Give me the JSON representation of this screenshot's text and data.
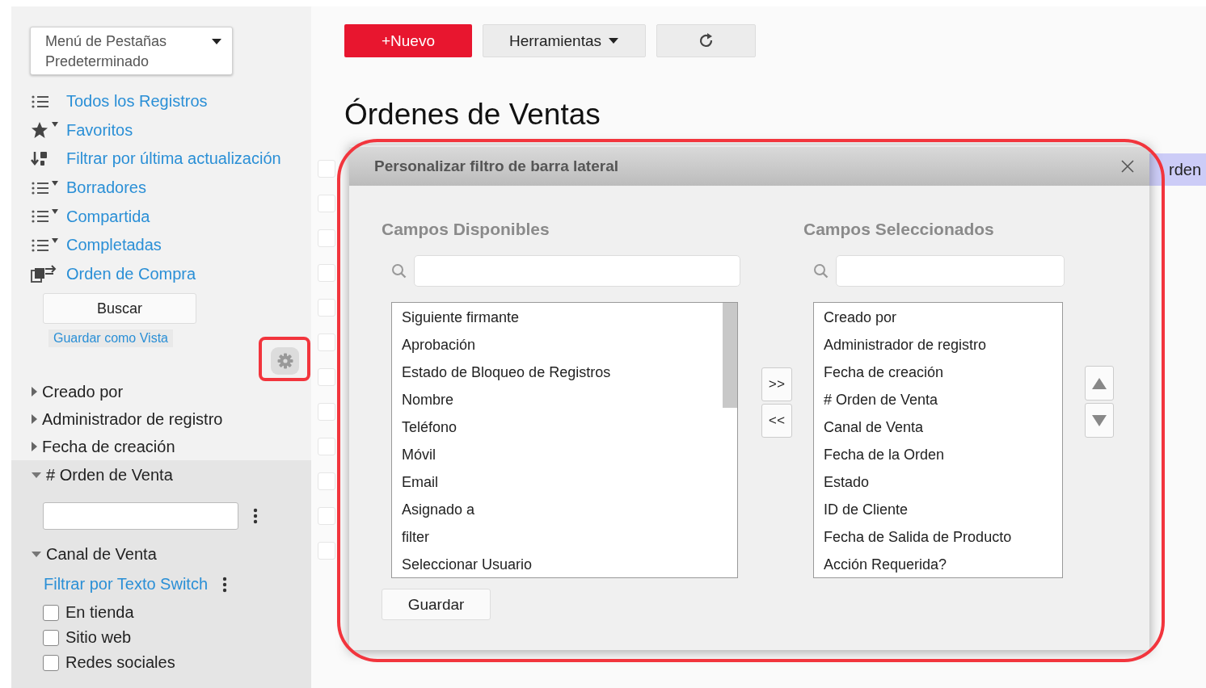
{
  "sidebar": {
    "tab_menu": {
      "label": "Menú de Pestañas Predeterminado"
    },
    "views": [
      {
        "label": "Todos los Registros",
        "kind": "list"
      },
      {
        "label": "Favoritos",
        "kind": "star"
      },
      {
        "label": "Filtrar por última actualización",
        "kind": "sort"
      },
      {
        "label": "Borradores",
        "kind": "filter"
      },
      {
        "label": "Compartida",
        "kind": "filter"
      },
      {
        "label": "Completadas",
        "kind": "filter"
      },
      {
        "label": "Orden de Compra",
        "kind": "transfer"
      }
    ],
    "search_button": "Buscar",
    "save_view_link": "Guardar como Vista",
    "filters": [
      {
        "label": "Creado por",
        "expanded": false
      },
      {
        "label": "Administrador de registro",
        "expanded": false
      },
      {
        "label": "Fecha de creación",
        "expanded": false
      },
      {
        "label": "# Orden de Venta",
        "expanded": true,
        "kind": "text"
      },
      {
        "label": "Canal de Venta",
        "expanded": true,
        "kind": "options",
        "link": "Filtrar por Texto Switch",
        "options": [
          {
            "label": "En tienda",
            "checked": false
          },
          {
            "label": "Sitio web",
            "checked": false
          },
          {
            "label": "Redes sociales",
            "checked": false
          }
        ]
      }
    ]
  },
  "toolbar": {
    "new_button": "+Nuevo",
    "tools_button": "Herramientas"
  },
  "page_title": "Órdenes de Ventas",
  "column_header": "rden",
  "rows": [
    {
      "checked": false
    },
    {
      "checked": false
    },
    {
      "checked": false
    },
    {
      "checked": false
    },
    {
      "checked": false
    },
    {
      "checked": false
    },
    {
      "checked": false
    },
    {
      "checked": false
    },
    {
      "checked": false
    },
    {
      "checked": false
    },
    {
      "checked": false
    },
    {
      "checked": false
    }
  ],
  "dialog": {
    "title": "Personalizar filtro de barra lateral",
    "available": {
      "heading": "Campos Disponibles",
      "items": [
        "Siguiente firmante",
        "Aprobación",
        "Estado de Bloqueo de Registros",
        "Nombre",
        "Teléfono",
        "Móvil",
        "Email",
        "Asignado a",
        "filter",
        "Seleccionar Usuario"
      ]
    },
    "selected": {
      "heading": "Campos Seleccionados",
      "items": [
        "Creado por",
        "Administrador de registro",
        "Fecha de creación",
        "# Orden de Venta",
        "Canal de Venta",
        "Fecha de la Orden",
        "Estado",
        "ID de Cliente",
        "Fecha de Salida de Producto",
        "Acción Requerida?"
      ]
    },
    "add_button": ">>",
    "remove_button": "<<",
    "save_button": "Guardar"
  }
}
